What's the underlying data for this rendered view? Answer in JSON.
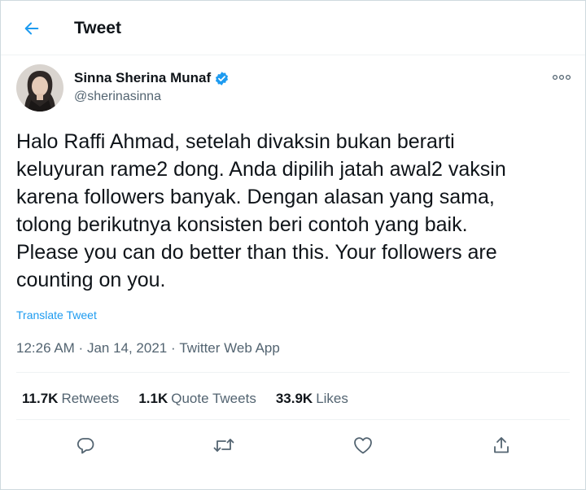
{
  "header": {
    "title": "Tweet"
  },
  "author": {
    "name": "Sinna Sherina Munaf",
    "handle": "@sherinasinna",
    "verified": true
  },
  "tweet": {
    "text": "Halo Raffi Ahmad, setelah divaksin bukan berarti\nkeluyuran rame2 dong. Anda dipilih jatah awal2 vaksin\nkarena followers banyak. Dengan alasan yang sama,\ntolong berikutnya konsisten beri contoh yang baik.\nPlease you can do better than this. Your followers are\ncounting on you.",
    "translate_label": "Translate Tweet",
    "time": "12:26 AM",
    "date": "Jan 14, 2021",
    "client": "Twitter Web App"
  },
  "stats": {
    "retweets": {
      "count": "11.7K",
      "label": "Retweets"
    },
    "quotes": {
      "count": "1.1K",
      "label": "Quote Tweets"
    },
    "likes": {
      "count": "33.9K",
      "label": "Likes"
    }
  },
  "colors": {
    "accent": "#1d9bf0",
    "muted": "#536471",
    "text": "#0f1419",
    "border": "#eff3f4"
  },
  "icons": [
    "back-arrow-icon",
    "verified-badge-icon",
    "more-options-icon",
    "reply-icon",
    "retweet-icon",
    "like-icon",
    "share-icon"
  ]
}
